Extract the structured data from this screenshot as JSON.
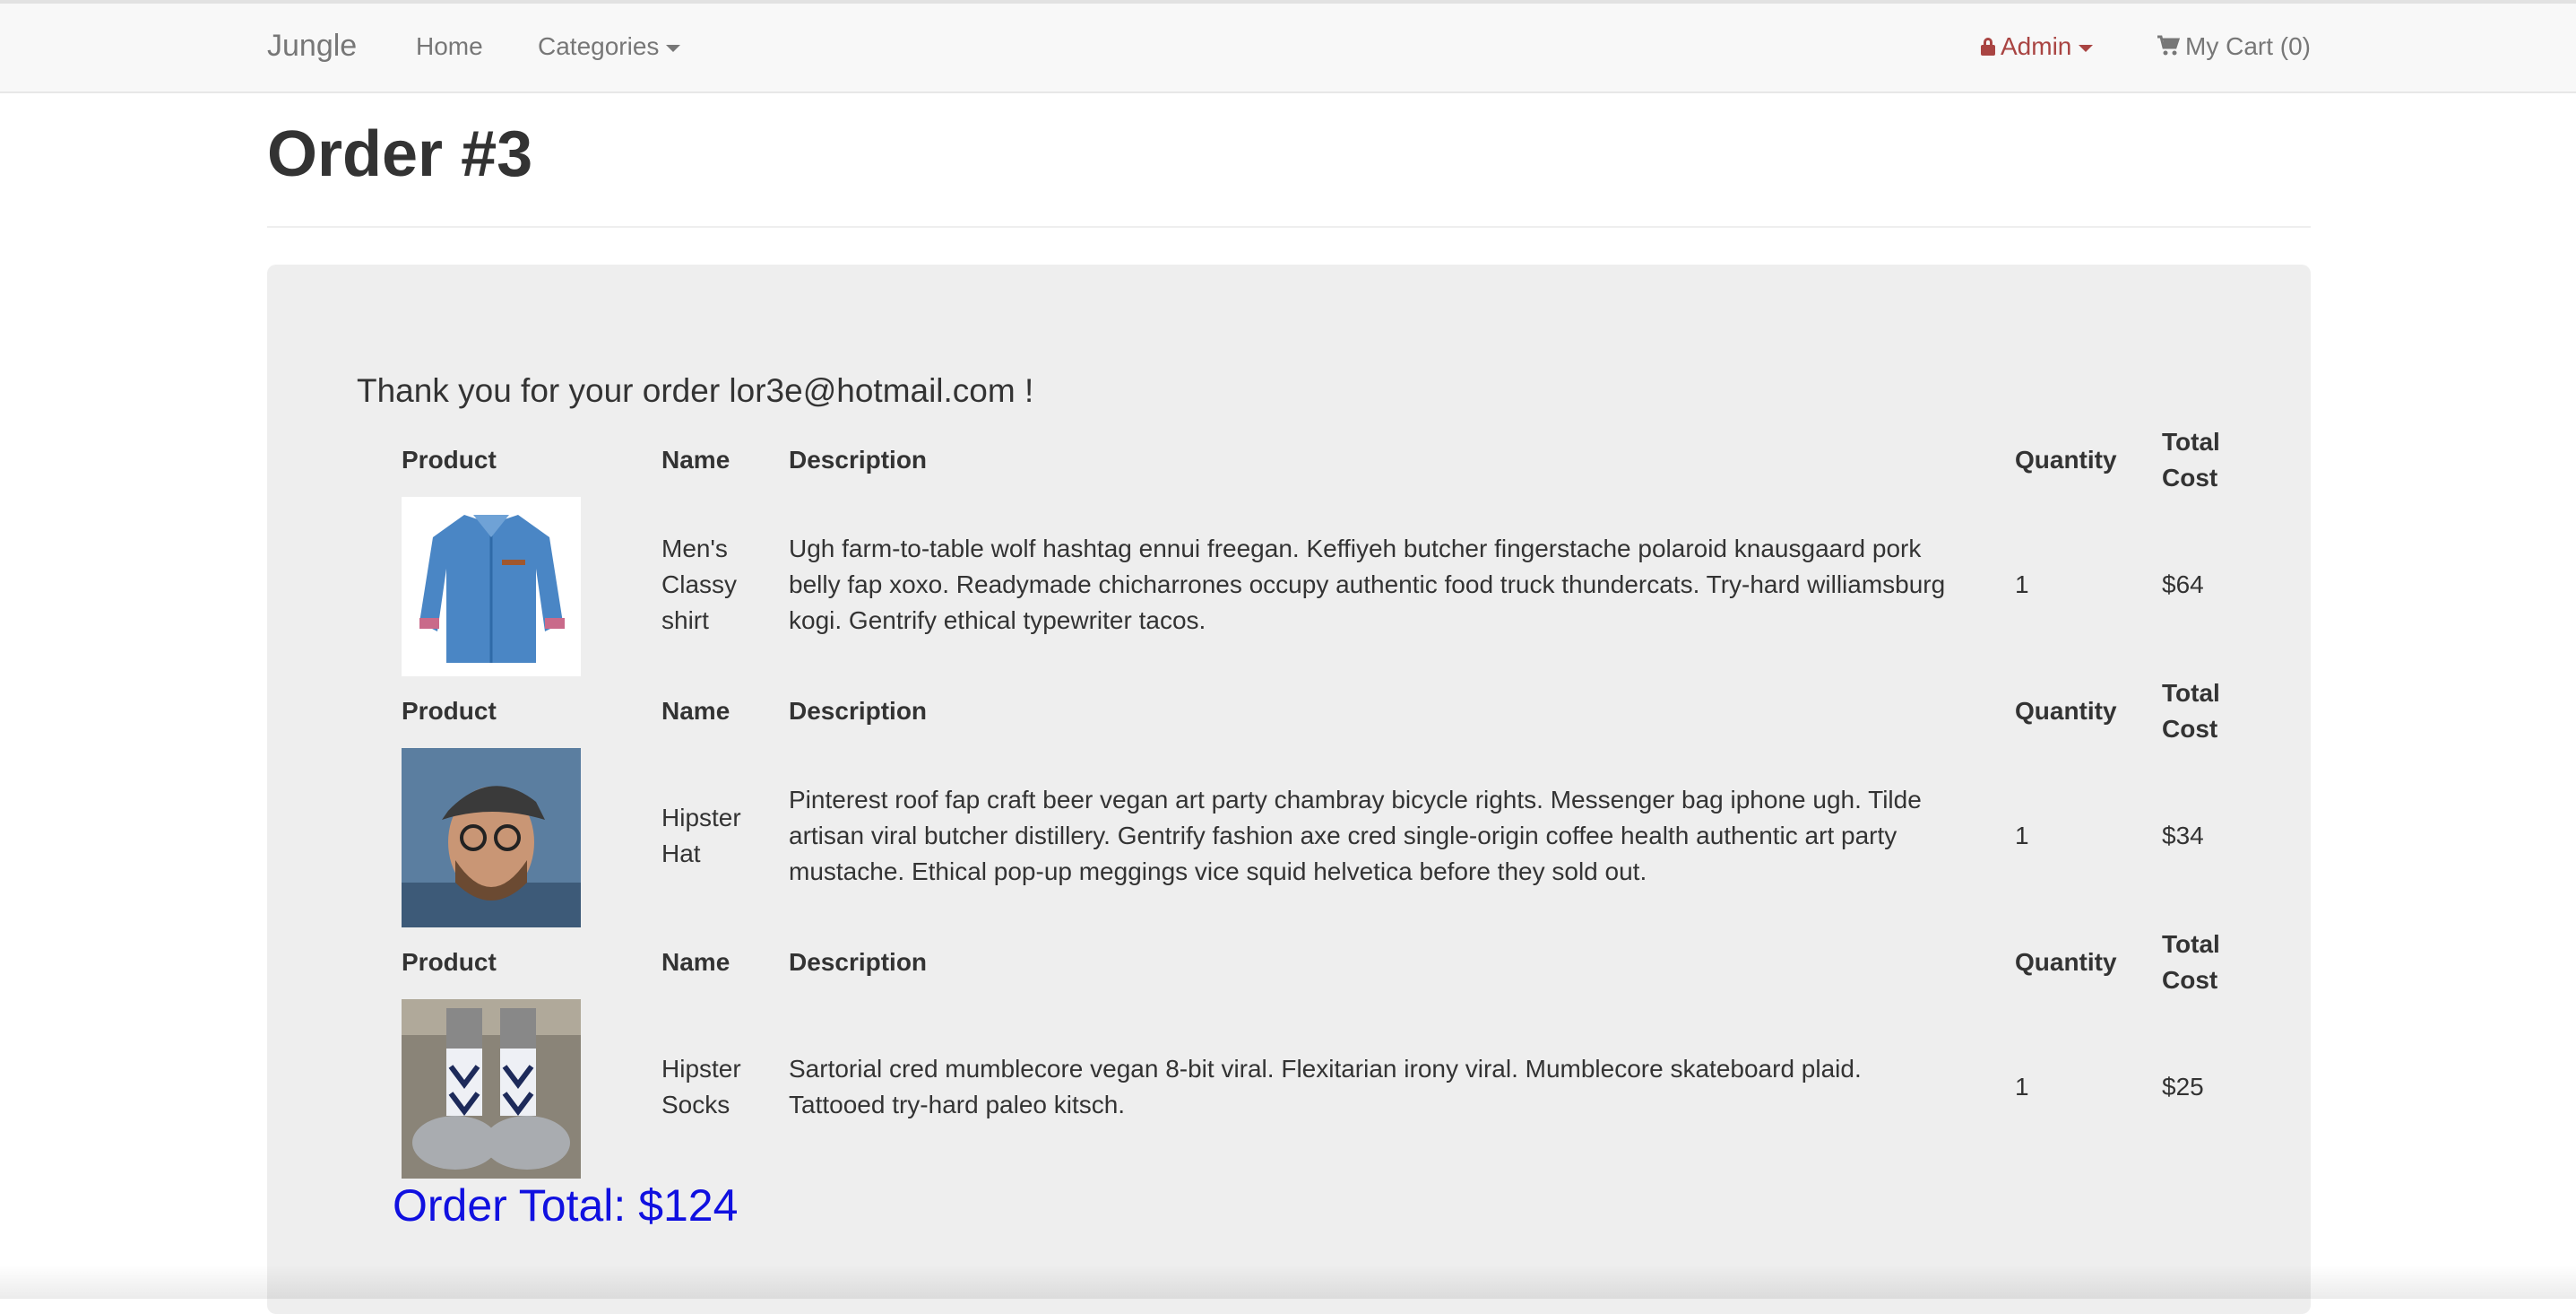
{
  "navbar": {
    "brand": "Jungle",
    "home": "Home",
    "categories": "Categories",
    "admin": "Admin",
    "cart": "My Cart (0)",
    "admin_color": "#a94442"
  },
  "page": {
    "title": "Order #3",
    "thank_you": "Thank you for your order lor3e@hotmail.com !",
    "order_total": "Order Total: $124",
    "total_color": "#1010e0"
  },
  "table": {
    "headers": {
      "product": "Product",
      "name": "Name",
      "description": "Description",
      "quantity": "Quantity",
      "total_cost_1": "Total",
      "total_cost_2": "Cost"
    },
    "rows": [
      {
        "image": "blue-denim-shirt",
        "name_lines": [
          "Men's",
          "Classy",
          "shirt"
        ],
        "description_lines": [
          "Ugh farm-to-table wolf hashtag ennui freegan. Keffiyeh butcher fingerstache polaroid knausgaard pork",
          "belly fap xoxo. Readymade chicharrones occupy authentic food truck thundercats. Try-hard williamsburg",
          "kogi. Gentrify ethical typewriter tacos."
        ],
        "quantity": "1",
        "total": "$64"
      },
      {
        "image": "man-in-flat-cap",
        "name_lines": [
          "Hipster",
          "Hat"
        ],
        "description_lines": [
          "Pinterest roof fap craft beer vegan art party chambray bicycle rights. Messenger bag iphone ugh. Tilde",
          "artisan viral butcher distillery. Gentrify fashion axe cred single-origin coffee health authentic art party",
          "mustache. Ethical pop-up meggings vice squid helvetica before they sold out."
        ],
        "quantity": "1",
        "total": "$34"
      },
      {
        "image": "patterned-socks-sneakers",
        "name_lines": [
          "Hipster",
          "Socks"
        ],
        "description_lines": [
          "Sartorial cred mumblecore vegan 8-bit viral. Flexitarian irony viral. Mumblecore skateboard plaid.",
          "Tattooed try-hard paleo kitsch."
        ],
        "quantity": "1",
        "total": "$25"
      }
    ]
  }
}
